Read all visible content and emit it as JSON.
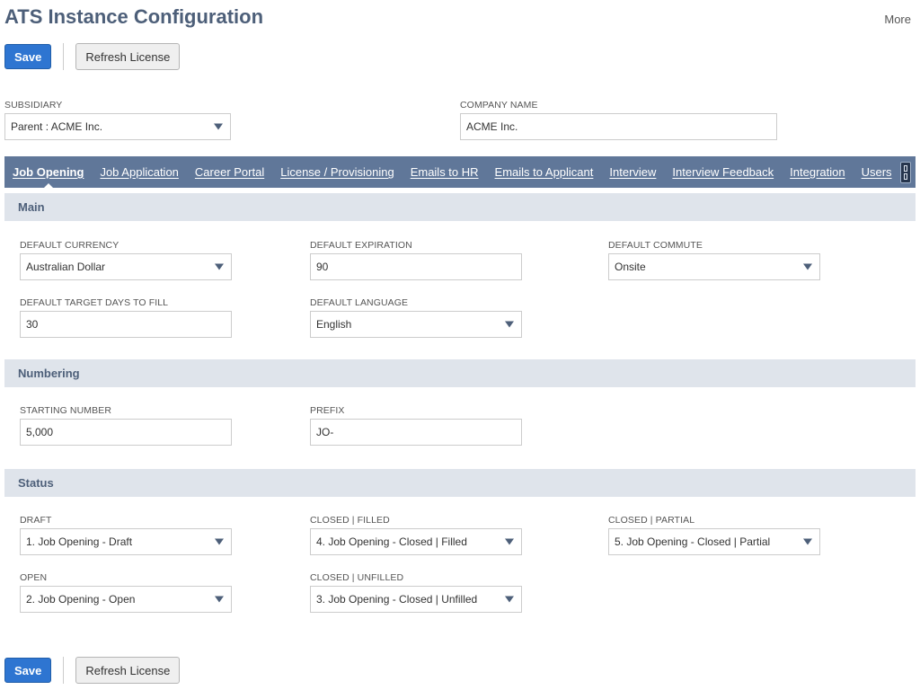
{
  "page": {
    "title": "ATS Instance Configuration",
    "more_label": "More"
  },
  "actions": {
    "save_label": "Save",
    "refresh_label": "Refresh License"
  },
  "header_fields": {
    "subsidiary": {
      "label": "SUBSIDIARY",
      "value": "Parent : ACME Inc."
    },
    "company_name": {
      "label": "COMPANY NAME",
      "value": "ACME Inc."
    }
  },
  "tabs": [
    {
      "label": "Job Opening",
      "active": true
    },
    {
      "label": "Job Application"
    },
    {
      "label": "Career Portal"
    },
    {
      "label": "License / Provisioning"
    },
    {
      "label": "Emails to HR"
    },
    {
      "label": "Emails to Applicant"
    },
    {
      "label": "Interview"
    },
    {
      "label": "Interview Feedback"
    },
    {
      "label": "Integration"
    },
    {
      "label": "Users"
    }
  ],
  "sections": {
    "main": {
      "title": "Main",
      "default_currency": {
        "label": "DEFAULT CURRENCY",
        "value": "Australian Dollar"
      },
      "default_expiration": {
        "label": "DEFAULT EXPIRATION",
        "value": "90"
      },
      "default_commute": {
        "label": "DEFAULT COMMUTE",
        "value": "Onsite"
      },
      "default_target_days": {
        "label": "DEFAULT TARGET DAYS TO FILL",
        "value": "30"
      },
      "default_language": {
        "label": "DEFAULT LANGUAGE",
        "value": "English"
      }
    },
    "numbering": {
      "title": "Numbering",
      "starting_number": {
        "label": "STARTING NUMBER",
        "value": "5,000"
      },
      "prefix": {
        "label": "PREFIX",
        "value": "JO-"
      }
    },
    "status": {
      "title": "Status",
      "draft": {
        "label": "DRAFT",
        "value": "1. Job Opening - Draft"
      },
      "closed_filled": {
        "label": "CLOSED | FILLED",
        "value": "4. Job Opening - Closed | Filled"
      },
      "closed_partial": {
        "label": "CLOSED | PARTIAL",
        "value": "5. Job Opening - Closed | Partial"
      },
      "open": {
        "label": "OPEN",
        "value": "2. Job Opening - Open"
      },
      "closed_unfilled": {
        "label": "CLOSED | UNFILLED",
        "value": "3. Job Opening - Closed | Unfilled"
      }
    }
  },
  "colors": {
    "accent": "#2e75d1",
    "tab_bar": "#607799",
    "section_bg": "#dfe4eb",
    "title": "#4d5f79"
  }
}
